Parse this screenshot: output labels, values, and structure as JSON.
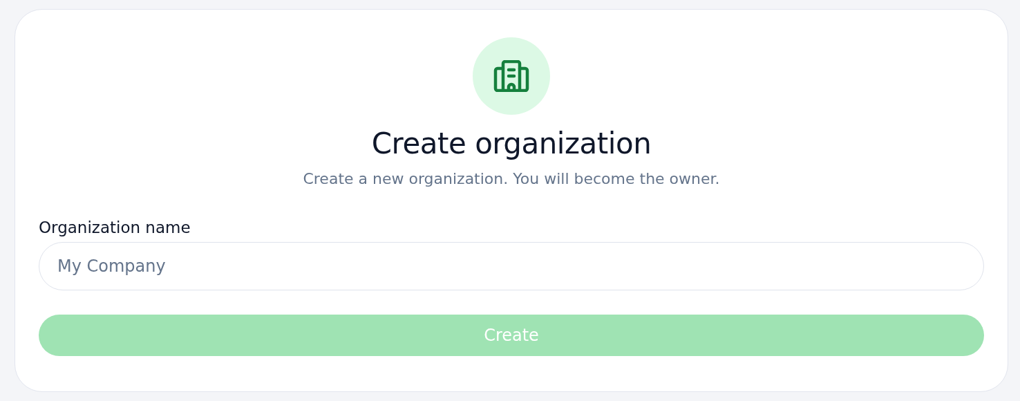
{
  "dialog": {
    "title": "Create organization",
    "subtitle": "Create a new organization. You will become the owner.",
    "field": {
      "label": "Organization name",
      "placeholder": "My Company"
    },
    "button": {
      "label": "Create",
      "disabled": true
    }
  }
}
